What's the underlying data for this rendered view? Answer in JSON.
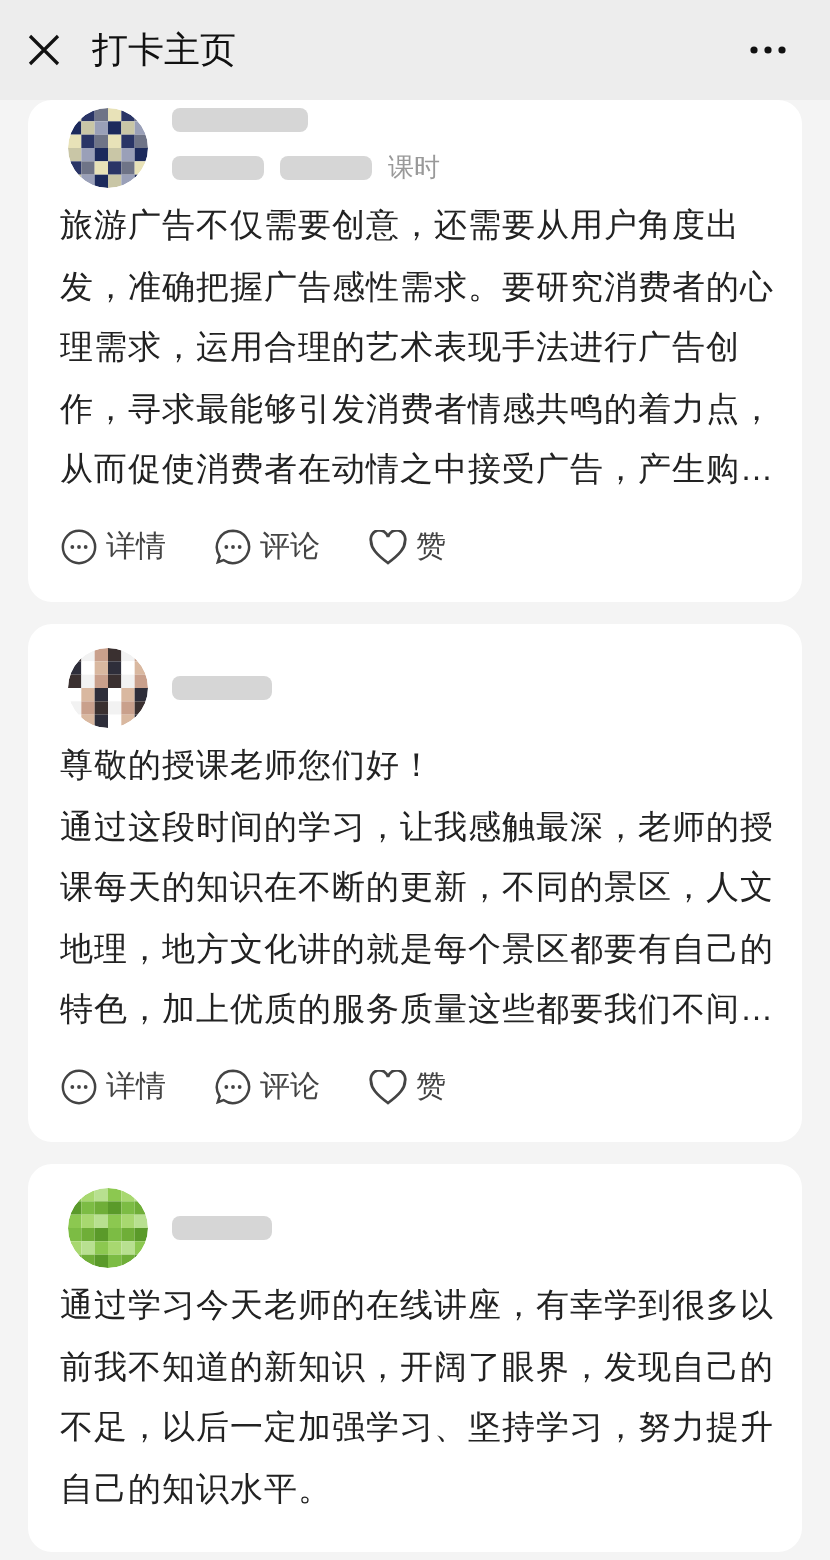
{
  "header": {
    "title": "打卡主页"
  },
  "posts": [
    {
      "meta_suffix": "课时",
      "paragraphs": [
        "旅游广告不仅需要创意，还需要从用户角度出发，准确把握广告感性需求。要研究消费者的心理需求，运用合理的艺术表现手法进行广告创作，寻求最能够引发消费者情感共鸣的着力点，从而促使消费者在动情之中接受广告，产生购…"
      ],
      "actions": [
        "详情",
        "评论",
        "赞"
      ]
    },
    {
      "paragraphs": [
        "尊敬的授课老师您们好！",
        "通过这段时间的学习，让我感触最深，老师的授课每天的知识在不断的更新，不同的景区，人文地理，地方文化讲的就是每个景区都要有自己的特色，加上优质的服务质量这些都要我们不间…"
      ],
      "actions": [
        "详情",
        "评论",
        "赞"
      ]
    },
    {
      "paragraphs": [
        "通过学习今天老师的在线讲座，有幸学到很多以前我不知道的新知识，开阔了眼界，发现自己的不足，以后一定加强学习、坚持学习，努力提升自己的知识水平。"
      ]
    }
  ]
}
